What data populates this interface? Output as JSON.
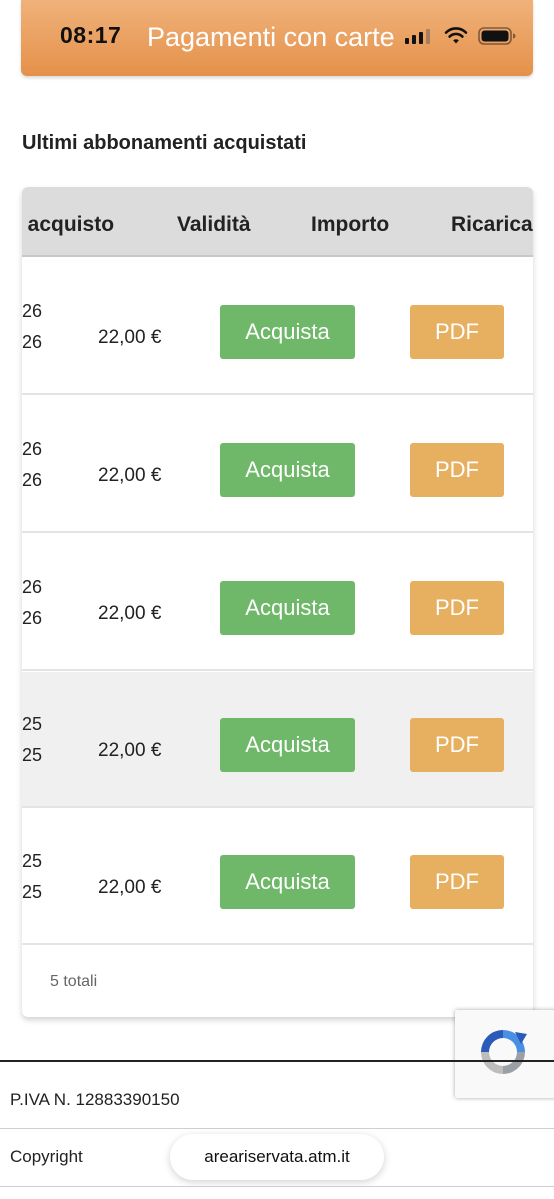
{
  "status_bar": {
    "time": "08:17"
  },
  "header": {
    "title": "Pagamenti con carte"
  },
  "section": {
    "title": "Ultimi abbonamenti acquistati"
  },
  "table": {
    "columns": [
      "i acquisto",
      "Validità",
      "Importo",
      "Ricarica"
    ],
    "rows": [
      {
        "date_line1": "26",
        "date_line2": "26",
        "amount": "22,00 €",
        "buy_label": "Acquista",
        "pdf_label": "PDF"
      },
      {
        "date_line1": "26",
        "date_line2": "26",
        "amount": "22,00 €",
        "buy_label": "Acquista",
        "pdf_label": "PDF"
      },
      {
        "date_line1": "26",
        "date_line2": "26",
        "amount": "22,00 €",
        "buy_label": "Acquista",
        "pdf_label": "PDF"
      },
      {
        "date_line1": "25",
        "date_line2": "25",
        "amount": "22,00 €",
        "buy_label": "Acquista",
        "pdf_label": "PDF"
      },
      {
        "date_line1": "25",
        "date_line2": "25",
        "amount": "22,00 €",
        "buy_label": "Acquista",
        "pdf_label": "PDF"
      }
    ],
    "total_label": "5 totali"
  },
  "footer": {
    "piva": "P.IVA N. 12883390150",
    "copyright": "Copyright"
  },
  "browser": {
    "url": "areariservata.atm.it"
  },
  "icons": {
    "signal": "cellular-signal-icon",
    "wifi": "wifi-icon",
    "battery": "battery-icon",
    "recaptcha": "recaptcha-logo-icon"
  },
  "colors": {
    "header_orange": "#e4914a",
    "buy_button_green": "#6fb86a",
    "pdf_button_orange": "#e6b060",
    "table_header_gray": "#dcdcdc"
  }
}
